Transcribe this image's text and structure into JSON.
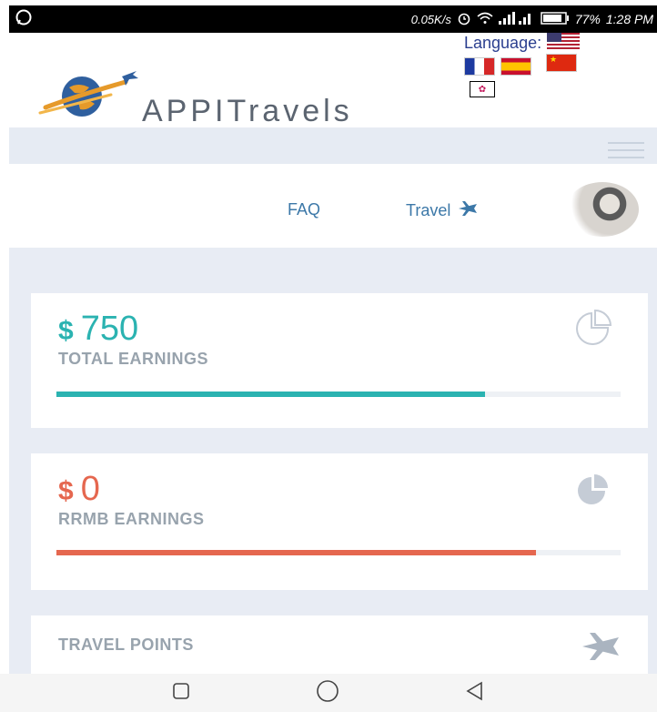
{
  "status_bar": {
    "net_speed": "0.05K/s",
    "battery": "77%",
    "time": "1:28 PM"
  },
  "header": {
    "brand": "APPITravels",
    "language_label": "Language:"
  },
  "nav": {
    "faq": "FAQ",
    "travel": "Travel"
  },
  "cards": {
    "total": {
      "currency": "$",
      "value": "750",
      "label": "TOTAL EARNINGS",
      "progress": 0.76,
      "color": "#2bb3b1"
    },
    "rrmb": {
      "currency": "$",
      "value": "0",
      "label": "RRMB EARNINGS",
      "progress": 0.85,
      "color": "#e5674f"
    },
    "travel_points": {
      "label": "TRAVEL POINTS"
    }
  }
}
